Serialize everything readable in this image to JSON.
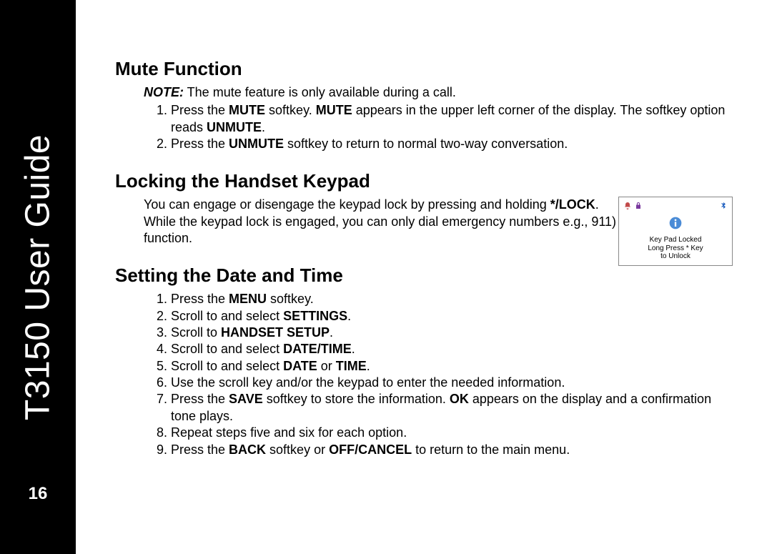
{
  "sidebar": {
    "title": "T3150 User Guide",
    "pageNumber": "16"
  },
  "sections": {
    "mute": {
      "heading": "Mute Function",
      "noteLabel": "NOTE:",
      "noteText": " The mute feature is only available during a call.",
      "step1_a": "Press the ",
      "step1_b": "MUTE",
      "step1_c": " softkey. ",
      "step1_d": "MUTE",
      "step1_e": " appears in the upper left corner of the display. The softkey option reads ",
      "step1_f": "UNMUTE",
      "step1_g": ".",
      "step2_a": "Press the ",
      "step2_b": "UNMUTE",
      "step2_c": " softkey to return to normal two-way conversation."
    },
    "lock": {
      "heading": "Locking the Handset Keypad",
      "p_a": "You can engage or disengage the keypad lock by pressing and holding ",
      "p_b": "*/LOCK",
      "p_c": ". While the keypad lock is engaged, you can only dial emergency numbers e.g., 911) function."
    },
    "datetime": {
      "heading": "Setting the Date and Time",
      "s1_a": "Press the ",
      "s1_b": "MENU",
      "s1_c": " softkey.",
      "s2_a": "Scroll to and select ",
      "s2_b": "SETTINGS",
      "s2_c": ".",
      "s3_a": "Scroll to ",
      "s3_b": "HANDSET SETUP",
      "s3_c": ".",
      "s4_a": "Scroll to and select ",
      "s4_b": "DATE/TIME",
      "s4_c": ".",
      "s5_a": "Scroll to and select ",
      "s5_b": "DATE",
      "s5_c": " or ",
      "s5_d": "TIME",
      "s5_e": ".",
      "s6": "Use the scroll key and/or the keypad to enter the needed information.",
      "s7_a": "Press the ",
      "s7_b": "SAVE",
      "s7_c": " softkey to store the information. ",
      "s7_d": "OK",
      "s7_e": " appears on the display and a confirmation tone plays.",
      "s8": "Repeat steps five and six for each option.",
      "s9_a": "Press the ",
      "s9_b": "BACK",
      "s9_c": " softkey or ",
      "s9_d": "OFF/CANCEL",
      "s9_e": " to return to the main menu."
    }
  },
  "figure": {
    "line1": "Key Pad Locked",
    "line2": "Long Press * Key",
    "line3": "to Unlock"
  }
}
